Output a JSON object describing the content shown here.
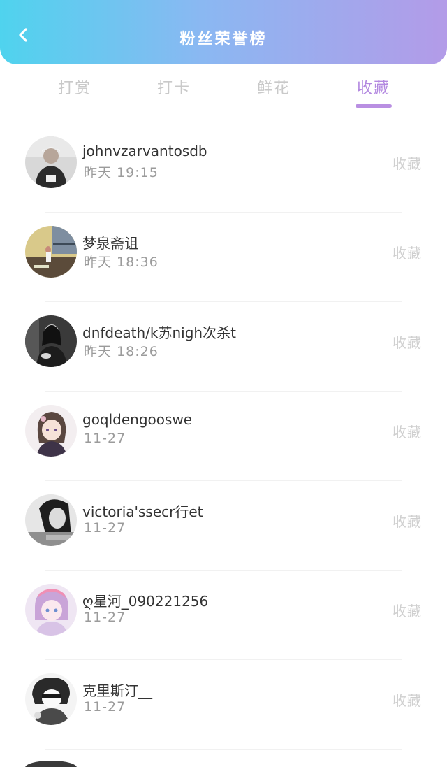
{
  "header": {
    "title": "粉丝荣誉榜",
    "back_icon": "chevron-left-icon",
    "gradient_start": "#4fd3ee",
    "gradient_end": "#b39be8"
  },
  "tabs": [
    {
      "label": "打赏",
      "active": false
    },
    {
      "label": "打卡",
      "active": false
    },
    {
      "label": "鲜花",
      "active": false
    },
    {
      "label": "收藏",
      "active": true
    }
  ],
  "accent_color": "#b388e0",
  "list": [
    {
      "name": "johnvzarvantosdb",
      "time": "昨天 19:15",
      "action": "收藏",
      "avatar": "avatar-photo"
    },
    {
      "name": "梦泉斋诅",
      "time": "昨天 18:36",
      "action": "收藏",
      "avatar": "avatar-photo"
    },
    {
      "name": "dnfdeath/k苏nigh次杀t",
      "time": "昨天 18:26",
      "action": "收藏",
      "avatar": "avatar-photo"
    },
    {
      "name": "goqldengooswe",
      "time": "11-27",
      "action": "收藏",
      "avatar": "avatar-anime"
    },
    {
      "name": "victoria'ssecr行et",
      "time": "11-27",
      "action": "收藏",
      "avatar": "avatar-photo"
    },
    {
      "name": "ღ星河_090221256",
      "time": "11-27",
      "action": "收藏",
      "avatar": "avatar-anime"
    },
    {
      "name": "克里斯汀__",
      "time": "11-27",
      "action": "收藏",
      "avatar": "avatar-sketch"
    }
  ]
}
